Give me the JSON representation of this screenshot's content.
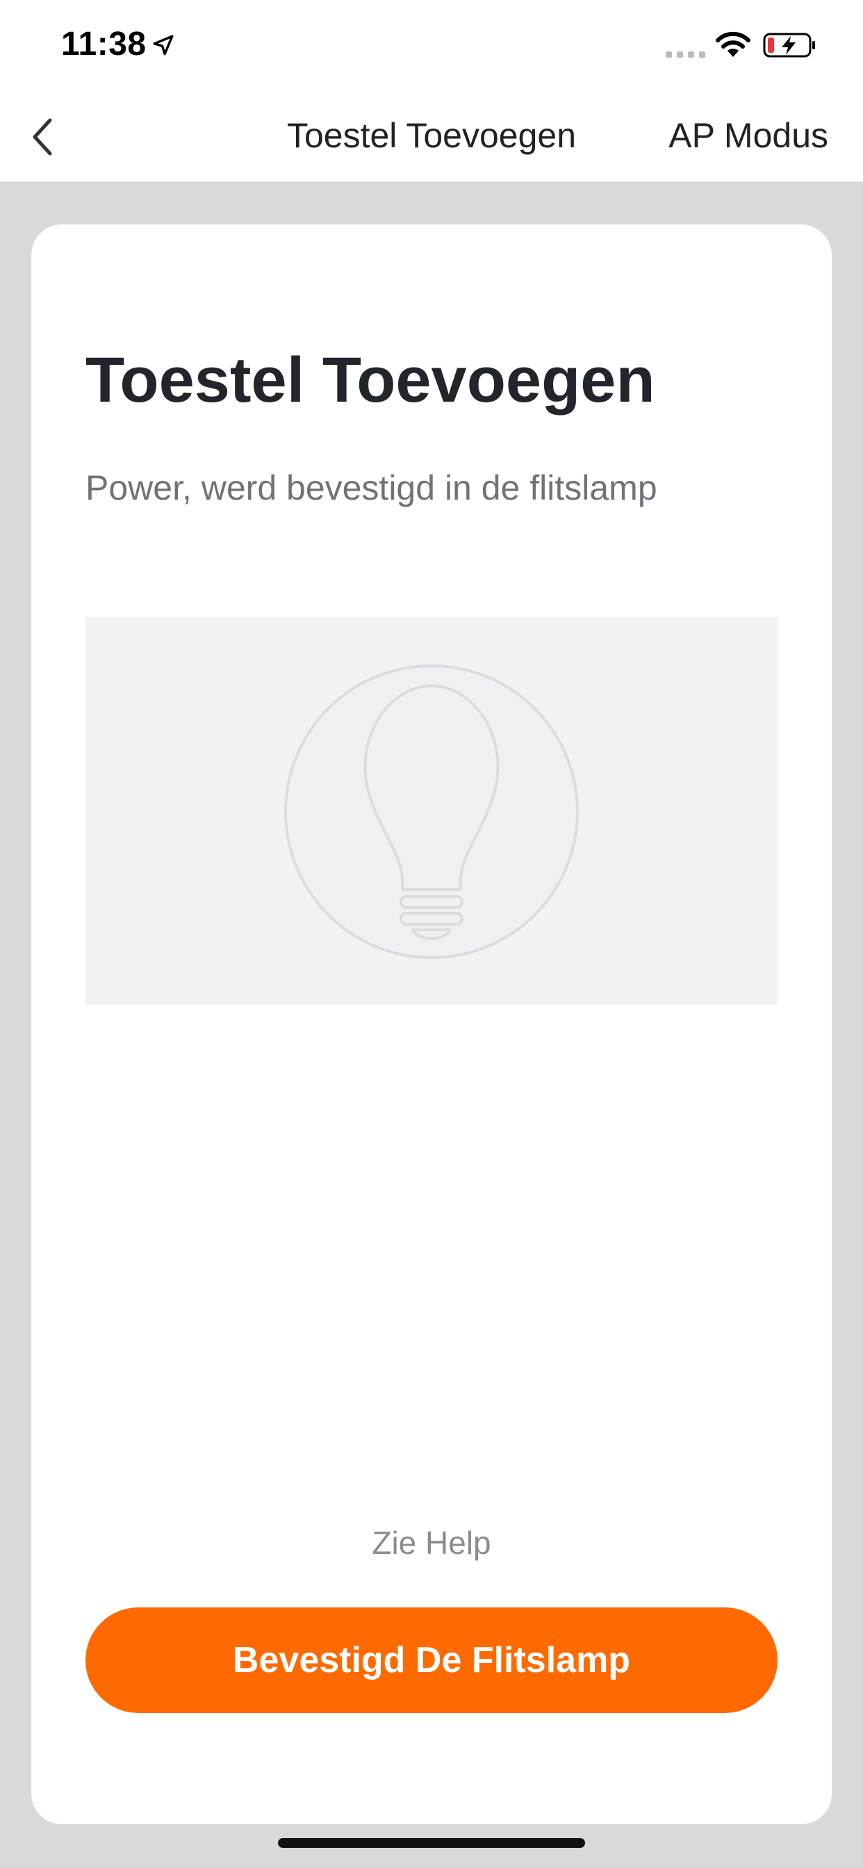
{
  "status_bar": {
    "time": "11:38",
    "icons": [
      "location-arrow-icon",
      "cellular-signal-icon",
      "wifi-icon",
      "battery-charging-icon"
    ]
  },
  "nav": {
    "title": "Toestel Toevoegen",
    "action_label": "AP Modus",
    "back_icon": "chevron-left-icon"
  },
  "card": {
    "title": "Toestel Toevoegen",
    "subtitle": "Power, werd bevestigd in de flitslamp",
    "image_icon": "light-bulb-icon",
    "help_label": "Zie Help",
    "confirm_label": "Bevestigd De Flitslamp"
  },
  "colors": {
    "accent": "#ff6a00",
    "background": "#d9d9d9",
    "card": "#ffffff",
    "battery_low": "#e8363a"
  }
}
